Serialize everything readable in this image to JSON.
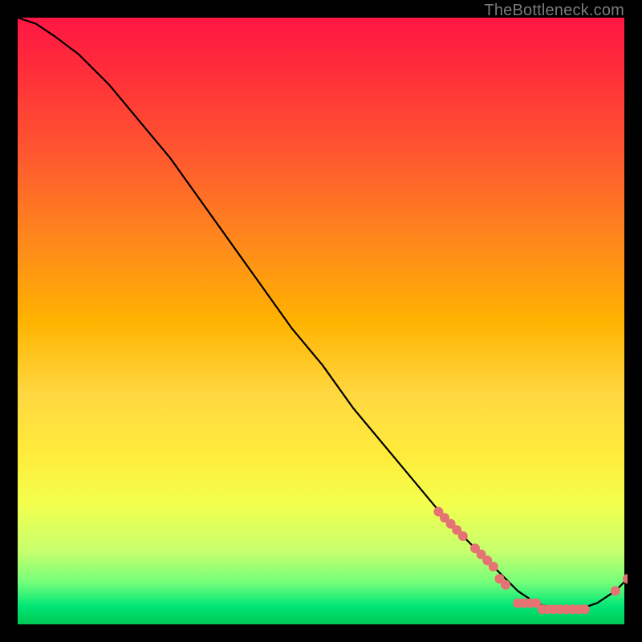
{
  "watermark": "TheBottleneck.com",
  "chart_data": {
    "type": "line",
    "title": "",
    "xlabel": "",
    "ylabel": "",
    "xlim": [
      0,
      100
    ],
    "ylim": [
      0,
      100
    ],
    "grid": false,
    "legend": false,
    "series": [
      {
        "name": "bottleneck-curve",
        "color": "#000000",
        "x": [
          0,
          3,
          6,
          10,
          15,
          20,
          25,
          30,
          35,
          40,
          45,
          50,
          55,
          60,
          65,
          70,
          75,
          80,
          82,
          85,
          88,
          90,
          92,
          95,
          98,
          100
        ],
        "y": [
          100,
          99,
          97,
          94,
          89,
          83,
          77,
          70,
          63,
          56,
          49,
          43,
          36,
          30,
          24,
          18,
          13,
          8,
          6,
          4,
          3,
          3,
          3,
          4,
          6,
          8
        ]
      }
    ],
    "markers": {
      "name": "highlighted-points",
      "color": "#e57373",
      "radius": 6,
      "points": [
        {
          "x": 69,
          "y": 19
        },
        {
          "x": 70,
          "y": 18
        },
        {
          "x": 71,
          "y": 17
        },
        {
          "x": 72,
          "y": 16
        },
        {
          "x": 73,
          "y": 15
        },
        {
          "x": 75,
          "y": 13
        },
        {
          "x": 76,
          "y": 12
        },
        {
          "x": 77,
          "y": 11
        },
        {
          "x": 78,
          "y": 10
        },
        {
          "x": 79,
          "y": 8
        },
        {
          "x": 80,
          "y": 7
        },
        {
          "x": 82,
          "y": 4
        },
        {
          "x": 83,
          "y": 4
        },
        {
          "x": 84,
          "y": 4
        },
        {
          "x": 85,
          "y": 4
        },
        {
          "x": 86,
          "y": 3
        },
        {
          "x": 87,
          "y": 3
        },
        {
          "x": 88,
          "y": 3
        },
        {
          "x": 89,
          "y": 3
        },
        {
          "x": 90,
          "y": 3
        },
        {
          "x": 91,
          "y": 3
        },
        {
          "x": 92,
          "y": 3
        },
        {
          "x": 93,
          "y": 3
        },
        {
          "x": 98,
          "y": 6
        },
        {
          "x": 100,
          "y": 8
        }
      ]
    },
    "background_gradient": {
      "top": "#ff1744",
      "middle": "#ffeb3b",
      "bottom": "#00c853"
    }
  }
}
